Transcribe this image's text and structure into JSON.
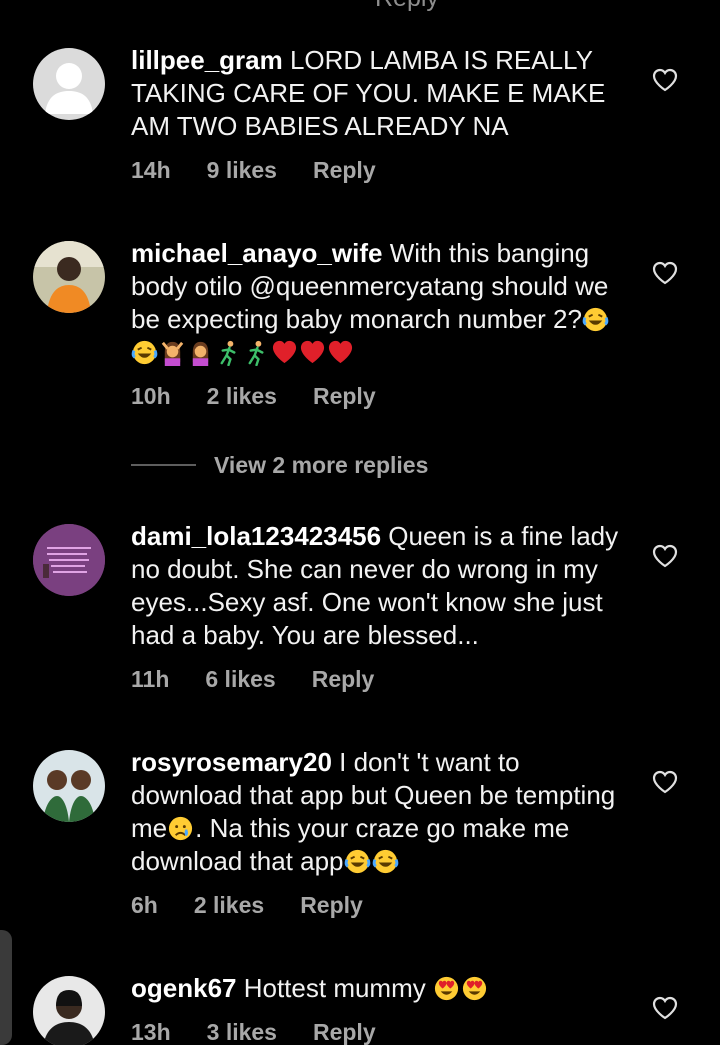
{
  "top_fragment": "Reply",
  "view_more_replies": "View 2 more replies",
  "comments": [
    {
      "username": "lillpee_gram",
      "text": " LORD LAMBA IS REALLY TAKING CARE OF YOU. MAKE E MAKE AM TWO BABIES ALREADY NA",
      "emojis": [],
      "time": "14h",
      "likes": "9 likes",
      "reply": "Reply",
      "avatar": "default-avatar"
    },
    {
      "username": "michael_anayo_wife",
      "text": " With this banging body otilo @queenmercyatang should we be expecting baby monarch number 2?",
      "emojis": [
        "laughing-tears",
        "laughing-tears",
        "woman-gesturing",
        "woman-facepalming",
        "running-man",
        "running-man",
        "red-heart",
        "red-heart",
        "red-heart"
      ],
      "time": "10h",
      "likes": "2 likes",
      "reply": "Reply",
      "avatar": "photo-avatar"
    },
    {
      "username": "dami_lola123423456",
      "text": " Queen is a fine lady no doubt. She can never do wrong in my eyes...Sexy asf. One won't know she just had a baby. You are blessed...",
      "emojis": [],
      "time": "11h",
      "likes": "6 likes",
      "reply": "Reply",
      "avatar": "pink-text-avatar"
    },
    {
      "username": "rosyrosemary20",
      "text_a": " I don't 't want to download that app but Queen be tempting me",
      "text_b": ". Na this your craze go make me download that app",
      "emojis": [
        "crying-face",
        "laughing-tears",
        "laughing-tears"
      ],
      "time": "6h",
      "likes": "2 likes",
      "reply": "Reply",
      "avatar": "photo-avatar"
    },
    {
      "username": "ogenk67",
      "text": " Hottest mummy ",
      "emojis": [
        "heart-eyes",
        "heart-eyes"
      ],
      "time": "13h",
      "likes": "3 likes",
      "reply": "Reply",
      "avatar": "photo-avatar"
    }
  ],
  "colors": {
    "background": "#000000",
    "text": "#f2f2f2",
    "meta": "#a8a8a8",
    "heart_outline": "#e0e0e0"
  }
}
